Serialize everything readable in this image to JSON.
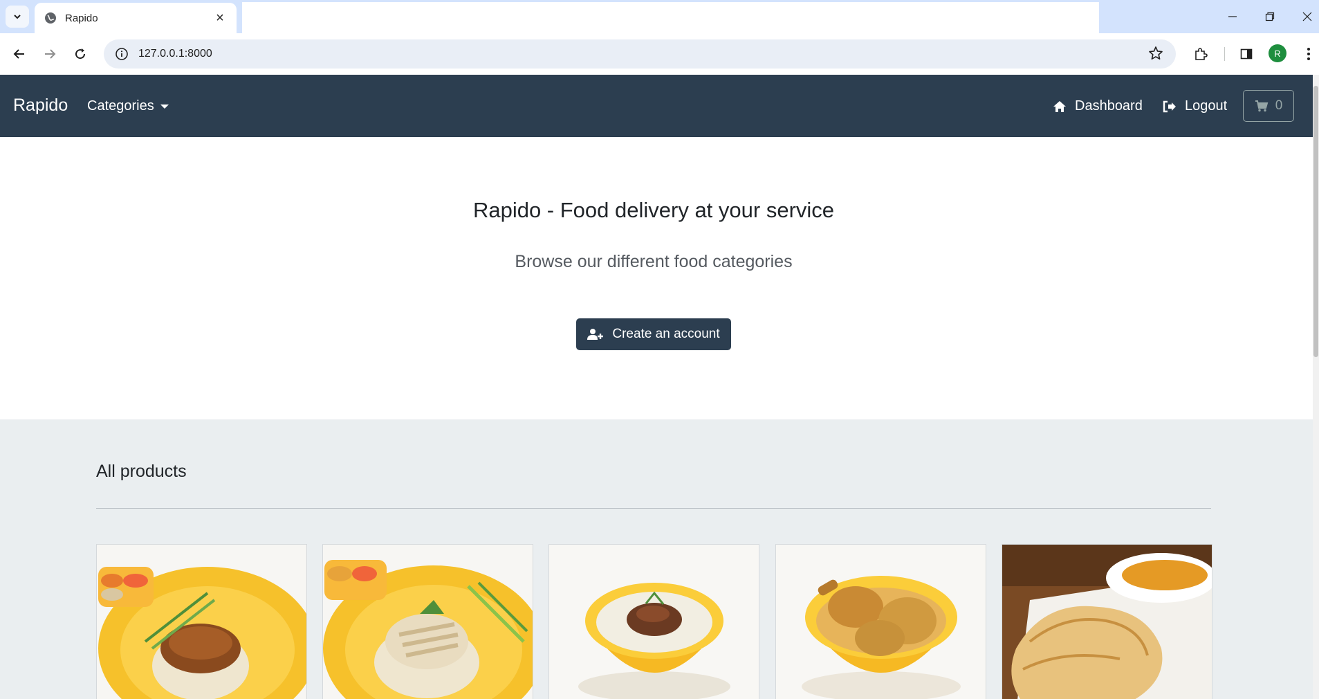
{
  "browser": {
    "tab_title": "Rapido",
    "url": "127.0.0.1:8000",
    "profile_initial": "R"
  },
  "navbar": {
    "brand": "Rapido",
    "categories_label": "Categories",
    "dashboard_label": "Dashboard",
    "logout_label": "Logout",
    "cart_count": "0"
  },
  "hero": {
    "title": "Rapido - Food delivery at your service",
    "subtitle": "Browse our different food categories",
    "cta_label": "Create an account"
  },
  "products": {
    "section_title": "All products",
    "items": [
      {
        "image": "roasted chicken rice on yellow plate"
      },
      {
        "image": "steamed chicken rice on yellow plate"
      },
      {
        "image": "porridge in yellow bowl"
      },
      {
        "image": "chicken curry in yellow bowl"
      },
      {
        "image": "roti prata with curry"
      }
    ]
  },
  "colors": {
    "navbar_bg": "#2c3e50",
    "hero_bg": "#ffffff",
    "page_bg": "#eaeef0",
    "accent_button": "#2c3e50"
  }
}
